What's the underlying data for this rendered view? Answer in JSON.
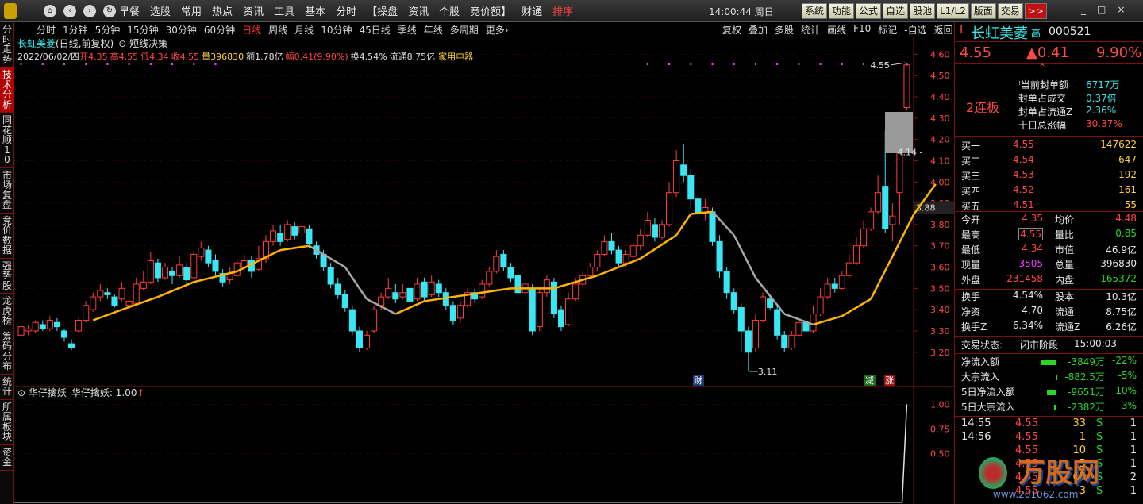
{
  "nav": {
    "back": "‹",
    "forward": "›",
    "home": "⌂",
    "refresh": "↻"
  },
  "menu": [
    {
      "label": "早餐",
      "hl": false
    },
    {
      "label": "选股",
      "hl": false
    },
    {
      "label": "常用",
      "hl": false
    },
    {
      "label": "热点",
      "hl": false
    },
    {
      "label": "资讯",
      "hl": false
    },
    {
      "label": "工具",
      "hl": false
    },
    {
      "label": "基本",
      "hl": false
    },
    {
      "label": "分时",
      "hl": false
    },
    {
      "label": "【操盘",
      "hl": false
    },
    {
      "label": "资讯",
      "hl": false
    },
    {
      "label": "个股",
      "hl": false
    },
    {
      "label": "竞价额】",
      "hl": false
    },
    {
      "label": "财通",
      "hl": false
    },
    {
      "label": "排序",
      "hl": true
    }
  ],
  "clock": "14:00:44 周日",
  "right_buttons": [
    "系统",
    "功能",
    "公式",
    "自选",
    "股池",
    "L1/L2",
    "版面",
    "交易"
  ],
  "more_button": ">>",
  "window_controls": {
    "min": "_",
    "max": "□",
    "close": "×"
  },
  "left_tabs": [
    {
      "label": "分时走势",
      "active": false
    },
    {
      "label": "技术分析",
      "active": true
    },
    {
      "label": "同花顺10",
      "active": false
    },
    {
      "label": "市场复盘",
      "active": false
    },
    {
      "label": "竞价数据",
      "active": false
    },
    {
      "label": "强势股",
      "active": false
    },
    {
      "label": "龙虎榜",
      "active": false
    },
    {
      "label": "筹码分布",
      "active": false
    },
    {
      "label": "统计",
      "active": false
    },
    {
      "label": "所属板块",
      "active": false
    },
    {
      "label": "资金",
      "active": false
    }
  ],
  "periods": [
    "分时",
    "1分钟",
    "5分钟",
    "15分钟",
    "30分钟",
    "60分钟",
    "日线",
    "周线",
    "月线",
    "10分钟",
    "45日线",
    "季线",
    "年线",
    "多周期",
    "更多›"
  ],
  "active_period": "日线",
  "chart_tools": [
    "复权",
    "叠加",
    "多股",
    "统计",
    "画线",
    "F10",
    "标记",
    "-自选",
    "返回"
  ],
  "chart": {
    "title_name": "长虹美菱",
    "title_type": "(日线,前复权)",
    "indicator_name": "短线决策",
    "info": {
      "date": "2022/06/02/四",
      "open_label": "开",
      "open": "4.35",
      "high_label": "高",
      "high": "4.55",
      "low_label": "低",
      "low": "4.34",
      "close_label": "收",
      "close": "4.55",
      "vol_label": "量",
      "vol": "396830",
      "amt_label": "额",
      "amt": "1.78亿",
      "chg_label": "幅",
      "chg": "0.41(9.90%)",
      "turn_label": "换",
      "turn": "4.54%",
      "float_label": "流通",
      "float": "8.75亿",
      "industry": "家用电器"
    },
    "price_axis": [
      "4.60",
      "4.50",
      "4.40",
      "4.30",
      "4.20",
      "4.10",
      "4.00",
      "3.90",
      "3.80",
      "3.70",
      "3.60",
      "3.50",
      "3.40",
      "3.30",
      "3.20"
    ],
    "current_price_tag": "3.88",
    "annot_high": "4.55",
    "annot_low": "3.11",
    "annot_right": "4.14",
    "markers": {
      "cai": "财",
      "jian": "减",
      "zhang": "涨"
    },
    "sub_title": "华仔擒妖",
    "sub_value_label": "华仔擒妖: 1.00",
    "sub_arrow": "↑",
    "sub_axis": [
      "1.00",
      "0.75",
      "0.50"
    ]
  },
  "chart_data": {
    "type": "candlestick",
    "ylim": [
      3.05,
      4.65
    ],
    "candles": [
      [
        3.28,
        3.32,
        3.34,
        3.26
      ],
      [
        3.3,
        3.31,
        3.33,
        3.28
      ],
      [
        3.3,
        3.34,
        3.35,
        3.29
      ],
      [
        3.33,
        3.31,
        3.35,
        3.3
      ],
      [
        3.31,
        3.35,
        3.37,
        3.3
      ],
      [
        3.34,
        3.32,
        3.36,
        3.3
      ],
      [
        3.3,
        3.27,
        3.31,
        3.25
      ],
      [
        3.24,
        3.22,
        3.26,
        3.21
      ],
      [
        3.3,
        3.35,
        3.36,
        3.29
      ],
      [
        3.35,
        3.42,
        3.44,
        3.34
      ],
      [
        3.4,
        3.46,
        3.48,
        3.39
      ],
      [
        3.46,
        3.49,
        3.52,
        3.44
      ],
      [
        3.48,
        3.47,
        3.5,
        3.45
      ],
      [
        3.46,
        3.42,
        3.47,
        3.41
      ],
      [
        3.45,
        3.5,
        3.53,
        3.44
      ],
      [
        3.42,
        3.44,
        3.46,
        3.4
      ],
      [
        3.43,
        3.52,
        3.55,
        3.42
      ],
      [
        3.5,
        3.53,
        3.58,
        3.49
      ],
      [
        3.53,
        3.63,
        3.67,
        3.52
      ],
      [
        3.62,
        3.55,
        3.64,
        3.53
      ],
      [
        3.55,
        3.6,
        3.62,
        3.54
      ],
      [
        3.58,
        3.56,
        3.6,
        3.52
      ],
      [
        3.56,
        3.61,
        3.65,
        3.55
      ],
      [
        3.6,
        3.54,
        3.62,
        3.52
      ],
      [
        3.55,
        3.66,
        3.68,
        3.54
      ],
      [
        3.65,
        3.69,
        3.72,
        3.63
      ],
      [
        3.68,
        3.62,
        3.7,
        3.6
      ],
      [
        3.63,
        3.58,
        3.66,
        3.56
      ],
      [
        3.57,
        3.53,
        3.59,
        3.51
      ],
      [
        3.54,
        3.57,
        3.6,
        3.52
      ],
      [
        3.56,
        3.62,
        3.64,
        3.55
      ],
      [
        3.6,
        3.63,
        3.66,
        3.58
      ],
      [
        3.63,
        3.58,
        3.65,
        3.55
      ],
      [
        3.59,
        3.64,
        3.7,
        3.58
      ],
      [
        3.64,
        3.72,
        3.75,
        3.62
      ],
      [
        3.72,
        3.77,
        3.8,
        3.7
      ],
      [
        3.76,
        3.72,
        3.8,
        3.7
      ],
      [
        3.73,
        3.8,
        3.82,
        3.72
      ],
      [
        3.79,
        3.75,
        3.81,
        3.73
      ],
      [
        3.76,
        3.79,
        3.81,
        3.74
      ],
      [
        3.78,
        3.71,
        3.8,
        3.69
      ],
      [
        3.7,
        3.66,
        3.72,
        3.64
      ],
      [
        3.66,
        3.6,
        3.68,
        3.58
      ],
      [
        3.6,
        3.52,
        3.62,
        3.5
      ],
      [
        3.52,
        3.47,
        3.55,
        3.45
      ],
      [
        3.47,
        3.41,
        3.49,
        3.39
      ],
      [
        3.4,
        3.3,
        3.42,
        3.28
      ],
      [
        3.3,
        3.22,
        3.32,
        3.2
      ],
      [
        3.22,
        3.28,
        3.3,
        3.21
      ],
      [
        3.3,
        3.4,
        3.42,
        3.29
      ],
      [
        3.42,
        3.46,
        3.48,
        3.4
      ],
      [
        3.46,
        3.5,
        3.55,
        3.45
      ],
      [
        3.48,
        3.45,
        3.52,
        3.43
      ],
      [
        3.46,
        3.48,
        3.52,
        3.45
      ],
      [
        3.5,
        3.44,
        3.52,
        3.42
      ],
      [
        3.45,
        3.52,
        3.55,
        3.44
      ],
      [
        3.53,
        3.46,
        3.55,
        3.44
      ],
      [
        3.47,
        3.53,
        3.56,
        3.46
      ],
      [
        3.52,
        3.48,
        3.54,
        3.46
      ],
      [
        3.48,
        3.42,
        3.5,
        3.4
      ],
      [
        3.42,
        3.35,
        3.44,
        3.33
      ],
      [
        3.36,
        3.42,
        3.44,
        3.34
      ],
      [
        3.42,
        3.48,
        3.5,
        3.41
      ],
      [
        3.48,
        3.45,
        3.5,
        3.43
      ],
      [
        3.46,
        3.52,
        3.54,
        3.45
      ],
      [
        3.52,
        3.58,
        3.6,
        3.51
      ],
      [
        3.58,
        3.65,
        3.68,
        3.57
      ],
      [
        3.66,
        3.6,
        3.68,
        3.58
      ],
      [
        3.6,
        3.55,
        3.62,
        3.53
      ],
      [
        3.56,
        3.48,
        3.58,
        3.46
      ],
      [
        3.48,
        3.52,
        3.55,
        3.46
      ],
      [
        3.5,
        3.3,
        3.52,
        3.28
      ],
      [
        3.32,
        3.48,
        3.5,
        3.3
      ],
      [
        3.48,
        3.54,
        3.56,
        3.46
      ],
      [
        3.53,
        3.38,
        3.55,
        3.36
      ],
      [
        3.4,
        3.32,
        3.42,
        3.3
      ],
      [
        3.33,
        3.45,
        3.48,
        3.32
      ],
      [
        3.45,
        3.52,
        3.55,
        3.44
      ],
      [
        3.52,
        3.56,
        3.58,
        3.5
      ],
      [
        3.56,
        3.6,
        3.62,
        3.55
      ],
      [
        3.6,
        3.66,
        3.68,
        3.58
      ],
      [
        3.66,
        3.72,
        3.75,
        3.65
      ],
      [
        3.72,
        3.68,
        3.76,
        3.66
      ],
      [
        3.68,
        3.62,
        3.7,
        3.6
      ],
      [
        3.62,
        3.66,
        3.68,
        3.6
      ],
      [
        3.65,
        3.7,
        3.72,
        3.63
      ],
      [
        3.7,
        3.75,
        3.78,
        3.68
      ],
      [
        3.75,
        3.82,
        3.86,
        3.74
      ],
      [
        3.8,
        3.74,
        3.83,
        3.72
      ],
      [
        3.74,
        3.8,
        3.82,
        3.73
      ],
      [
        3.8,
        3.95,
        4.0,
        3.79
      ],
      [
        3.95,
        4.1,
        4.15,
        3.93
      ],
      [
        4.08,
        4.03,
        4.18,
        4.0
      ],
      [
        4.03,
        3.92,
        4.06,
        3.88
      ],
      [
        3.92,
        3.85,
        3.94,
        3.83
      ],
      [
        3.85,
        3.88,
        3.92,
        3.82
      ],
      [
        3.86,
        3.72,
        3.88,
        3.7
      ],
      [
        3.72,
        3.58,
        3.75,
        3.55
      ],
      [
        3.58,
        3.48,
        3.6,
        3.45
      ],
      [
        3.48,
        3.4,
        3.5,
        3.38
      ],
      [
        3.41,
        3.3,
        3.43,
        3.2
      ],
      [
        3.3,
        3.2,
        3.32,
        3.11
      ],
      [
        3.22,
        3.35,
        3.38,
        3.2
      ],
      [
        3.35,
        3.46,
        3.48,
        3.34
      ],
      [
        3.45,
        3.41,
        3.47,
        3.4
      ],
      [
        3.4,
        3.28,
        3.42,
        3.26
      ],
      [
        3.28,
        3.22,
        3.3,
        3.2
      ],
      [
        3.22,
        3.28,
        3.3,
        3.21
      ],
      [
        3.28,
        3.34,
        3.36,
        3.27
      ],
      [
        3.34,
        3.3,
        3.38,
        3.28
      ],
      [
        3.3,
        3.38,
        3.42,
        3.29
      ],
      [
        3.38,
        3.46,
        3.5,
        3.37
      ],
      [
        3.46,
        3.52,
        3.55,
        3.45
      ],
      [
        3.52,
        3.5,
        3.55,
        3.48
      ],
      [
        3.5,
        3.56,
        3.58,
        3.49
      ],
      [
        3.56,
        3.62,
        3.66,
        3.55
      ],
      [
        3.62,
        3.7,
        3.74,
        3.61
      ],
      [
        3.7,
        3.78,
        3.82,
        3.69
      ],
      [
        3.78,
        3.86,
        3.88,
        3.77
      ],
      [
        3.86,
        3.95,
        4.03,
        3.85
      ],
      [
        3.98,
        3.78,
        4.24,
        3.76
      ],
      [
        3.8,
        3.84,
        3.9,
        3.72
      ],
      [
        3.95,
        4.14,
        4.14,
        3.8
      ],
      [
        4.35,
        4.55,
        4.55,
        4.34
      ]
    ],
    "ma": [
      [
        10,
        3.35
      ],
      [
        14,
        3.4
      ],
      [
        19,
        3.46
      ],
      [
        24,
        3.53
      ],
      [
        30,
        3.58
      ],
      [
        36,
        3.68
      ],
      [
        40,
        3.7
      ],
      [
        45,
        3.6
      ],
      [
        48,
        3.45
      ],
      [
        52,
        3.38
      ],
      [
        56,
        3.44
      ],
      [
        62,
        3.47
      ],
      [
        68,
        3.5
      ],
      [
        74,
        3.5
      ],
      [
        80,
        3.56
      ],
      [
        86,
        3.64
      ],
      [
        91,
        3.75
      ],
      [
        93,
        3.85
      ],
      [
        96,
        3.86
      ],
      [
        99,
        3.75
      ],
      [
        102,
        3.55
      ],
      [
        106,
        3.38
      ],
      [
        110,
        3.33
      ],
      [
        114,
        3.37
      ],
      [
        118,
        3.45
      ],
      [
        121,
        3.65
      ],
      [
        124,
        3.85
      ],
      [
        127,
        3.99
      ]
    ],
    "last_price": 4.55,
    "tag_price": 3.88,
    "sub_ylim": [
      0,
      1.1
    ]
  },
  "stock": {
    "code_prefix": "L",
    "name": "长虹美菱",
    "name_suffix": "高",
    "code": "000521",
    "price": "4.55",
    "change": "▲0.41",
    "change_pct": "9.90%",
    "limit_count": "2连板"
  },
  "seal": [
    {
      "label": "当前封单额",
      "value": "6717万"
    },
    {
      "label": "封单占成交",
      "value": "0.37倍"
    },
    {
      "label": "封单占流通Z",
      "value": "2.36%"
    },
    {
      "label": "十日总涨幅",
      "value": "30.37%"
    }
  ],
  "bids": [
    {
      "label": "买一",
      "price": "4.55",
      "vol": "147622"
    },
    {
      "label": "买二",
      "price": "4.54",
      "vol": "647"
    },
    {
      "label": "买三",
      "price": "4.53",
      "vol": "192"
    },
    {
      "label": "买四",
      "price": "4.52",
      "vol": "161"
    },
    {
      "label": "买五",
      "price": "4.51",
      "vol": "55"
    }
  ],
  "quote": [
    {
      "l1": "今开",
      "v1": "4.35",
      "c1": "red",
      "l2": "均价",
      "v2": "4.48",
      "c2": "red"
    },
    {
      "l1": "最高",
      "v1": "4.55",
      "c1": "red",
      "l2": "量比",
      "v2": "0.85",
      "c2": "grn"
    },
    {
      "l1": "最低",
      "v1": "4.34",
      "c1": "red",
      "l2": "市值",
      "v2": "46.9亿",
      "c2": "wh"
    },
    {
      "l1": "现量",
      "v1": "3505",
      "c1": "mg",
      "l2": "总量",
      "v2": "396830",
      "c2": "wh"
    },
    {
      "l1": "外盘",
      "v1": "231458",
      "c1": "red",
      "l2": "内盘",
      "v2": "165372",
      "c2": "grn"
    }
  ],
  "stats": [
    {
      "l1": "换手",
      "v1": "4.54%",
      "l2": "股本",
      "v2": "10.3亿"
    },
    {
      "l1": "净资",
      "v1": "4.70",
      "l2": "流通",
      "v2": "8.75亿"
    },
    {
      "l1": "换手Z",
      "v1": "6.34%",
      "l2": "流通Z",
      "v2": "6.26亿"
    }
  ],
  "trade_state": {
    "label": "交易状态:",
    "value": "闭市阶段",
    "time": "15:00:03"
  },
  "flows": [
    {
      "label": "净流入额",
      "value": "-3849万",
      "pct": "-22%",
      "bar": 40
    },
    {
      "label": "大宗流入",
      "value": "-882.5万",
      "pct": "-5%",
      "bar": 2
    },
    {
      "label": "5日净流入额",
      "value": "-9651万",
      "pct": "-10%",
      "bar": 25
    },
    {
      "label": "5日大宗流入",
      "value": "-2382万",
      "pct": "-3%",
      "bar": 6
    }
  ],
  "ticks": [
    {
      "time": "14:55",
      "price": "4.55",
      "vol": "33",
      "side": "S",
      "n": "1"
    },
    {
      "time": "14:56",
      "price": "4.55",
      "vol": "1",
      "side": "S",
      "n": "1"
    },
    {
      "time": "",
      "price": "4.55",
      "vol": "10",
      "side": "S",
      "n": "1"
    },
    {
      "time": "",
      "price": "4.55",
      "vol": "5",
      "side": "S",
      "n": "1"
    },
    {
      "time": "",
      "price": "4.55",
      "vol": "65",
      "side": "S",
      "n": "2"
    },
    {
      "time": "",
      "price": "4.55",
      "vol": "3",
      "side": "S",
      "n": "1"
    }
  ],
  "watermark": {
    "text": "万股网",
    "url": "www.201062.com"
  },
  "colors": {
    "up": "#ff3c3c",
    "down": "#39e6f4",
    "ma": "#ffb400",
    "ma_down": "#a8a8a8",
    "axis_red": "#8a1616"
  }
}
